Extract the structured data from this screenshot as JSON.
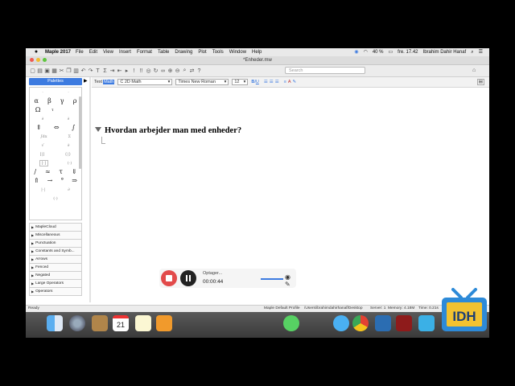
{
  "menubar": {
    "app": "Maple 2017",
    "items": [
      "File",
      "Edit",
      "View",
      "Insert",
      "Format",
      "Table",
      "Drawing",
      "Plot",
      "Tools",
      "Window",
      "Help"
    ],
    "battery": "40 %",
    "clock": "fre. 17.42",
    "user": "Ibrahim Dahir Hanaf"
  },
  "window": {
    "title": "*Enheder.mw"
  },
  "toolbar": {
    "search_placeholder": "Search"
  },
  "formatbar": {
    "mode_text": "Text",
    "mode_math": "Math",
    "style_select": "C  2D Math",
    "font_select": "Times New Roman",
    "size_select": "12"
  },
  "palettes": {
    "header": "Palettes",
    "sections": [
      "MapleCloud",
      "Miscellaneous",
      "Punctuation",
      "Constants and Symb...",
      "Arrows",
      "Fenced",
      "Negated",
      "Large Operators",
      "Operators"
    ]
  },
  "document": {
    "heading": "Hvordan arbejder man med enheder?"
  },
  "statusbar": {
    "left": "Ready",
    "profile": "Maple Default Profile",
    "path": "/Users/ibrahimdahirhanaf/Desktop",
    "server": "Server: 1",
    "memory": "Memory: 4.18M",
    "time": "Time: 0.21s"
  },
  "recorder": {
    "label": "Optager...",
    "time": "00:00:44"
  },
  "watermark": {
    "text": "IDH"
  },
  "colors": {
    "accent": "#3d7be0",
    "record": "#e24a4a",
    "logo_blue": "#2d8ad8"
  }
}
